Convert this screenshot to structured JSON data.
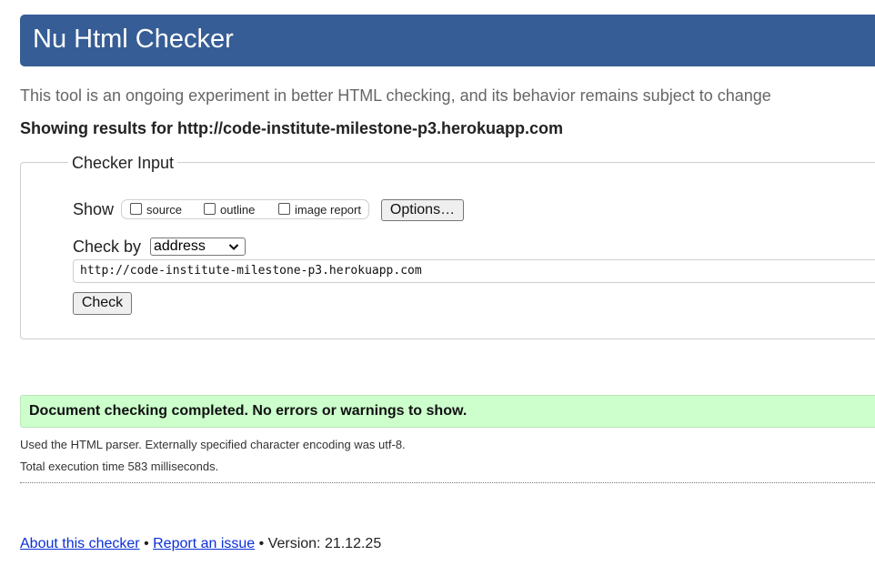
{
  "header": {
    "title": "Nu Html Checker"
  },
  "intro": "This tool is an ongoing experiment in better HTML checking, and its behavior remains subject to change",
  "showing": "Showing results for http://code-institute-milestone-p3.herokuapp.com",
  "checker_input": {
    "legend": "Checker Input",
    "show_label": "Show",
    "checkboxes": [
      {
        "label": "source",
        "checked": false
      },
      {
        "label": "outline",
        "checked": false
      },
      {
        "label": "image report",
        "checked": false
      }
    ],
    "options_button": "Options…",
    "check_by_label": "Check by",
    "check_by_value": "address",
    "url_value": "http://code-institute-milestone-p3.herokuapp.com",
    "check_button": "Check"
  },
  "result": {
    "success_message": "Document checking completed. No errors or warnings to show.",
    "parser_info": "Used the HTML parser. Externally specified character encoding was utf-8.",
    "execution_time": "Total execution time 583 milliseconds."
  },
  "footer": {
    "about_link": "About this checker",
    "separator1": " • ",
    "report_link": "Report an issue",
    "version_text": " • Version: 21.12.25"
  },
  "colors": {
    "header_bg": "#365d95",
    "success_bg": "#ccffcc",
    "link": "#0b2fd6"
  }
}
